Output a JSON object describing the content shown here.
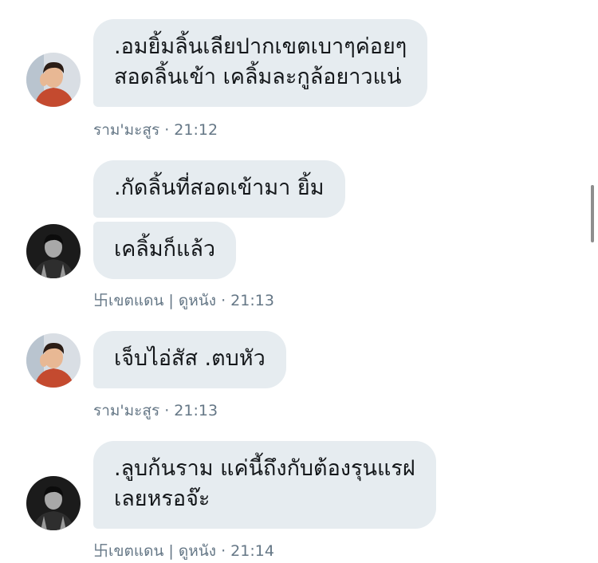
{
  "colors": {
    "bubble_bg": "#e6ecf0",
    "bubble_text": "#14171a",
    "meta_text": "#657786",
    "background": "#ffffff"
  },
  "messages": [
    {
      "lines": [
        ".อมยิ้มลิ้นเลียปากเขตเบาๆค่อยๆ",
        "สอดลิ้นเข้า เคลิ้มละกูล้อยาวแน่"
      ],
      "sender": "ราม'มะสูร",
      "time": "21:12",
      "avatar_icon": "profile-photo-pink-shirt"
    },
    {
      "lines": [
        ".กัดลิ้นที่สอดเข้ามา ยิ้ม"
      ]
    },
    {
      "lines": [
        "เคลิ้มก็แล้ว"
      ],
      "sender": "卐เขตแดน | ดูหนัง",
      "time": "21:13",
      "avatar_icon": "profile-photo-monochrome"
    },
    {
      "lines": [
        "เจ็บไอ่สัส .ตบหัว"
      ],
      "sender": "ราม'มะสูร",
      "time": "21:13",
      "avatar_icon": "profile-photo-pink-shirt"
    },
    {
      "lines": [
        ".ลูบก้นราม แค่นี้ถึงกับต้องรุนแรฝ",
        "เลยหรอจ๊ะ"
      ],
      "sender": "卐เขตแดน | ดูหนัง",
      "time": "21:14",
      "avatar_icon": "profile-photo-monochrome"
    }
  ]
}
